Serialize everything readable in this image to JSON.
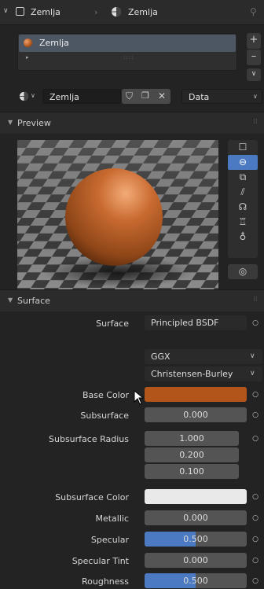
{
  "header": {
    "object_name": "Zemlja",
    "material_name": "Zemlja"
  },
  "slots": {
    "items": [
      "Zemlja"
    ],
    "add": "+",
    "remove": "–"
  },
  "material_selector": {
    "name": "Zemlja",
    "link_mode": "Data"
  },
  "panels": {
    "preview_title": "Preview",
    "surface_title": "Surface"
  },
  "surface": {
    "surface_label": "Surface",
    "surface_value": "Principled BSDF",
    "distribution": "GGX",
    "subsurface_method": "Christensen-Burley",
    "base_color_label": "Base Color",
    "base_color_hex": "#b1551b",
    "subsurface_label": "Subsurface",
    "subsurface_value": "0.000",
    "subsurface_radius_label": "Subsurface Radius",
    "subsurface_radius": [
      "1.000",
      "0.200",
      "0.100"
    ],
    "subsurface_color_label": "Subsurface Color",
    "subsurface_color_hex": "#e9e9e9",
    "metallic_label": "Metallic",
    "metallic_value": "0.000",
    "specular_label": "Specular",
    "specular_value": "0.500",
    "specular_fraction": 0.5,
    "specular_tint_label": "Specular Tint",
    "specular_tint_value": "0.000",
    "roughness_label": "Roughness",
    "roughness_value": "0.500",
    "roughness_fraction": 0.5
  },
  "colors": {
    "accent": "#4b7ac2",
    "slot_highlight": "#4d5764",
    "panel_bg": "#232323"
  },
  "icons": [
    "material-sphere-icon",
    "pin-icon",
    "shield-icon",
    "copy-icon",
    "close-icon",
    "flat-icon",
    "sphere-icon",
    "cube-icon",
    "hair-icon",
    "monkey-icon",
    "cloth-icon",
    "fluid-icon",
    "world-icon",
    "eyedropper-cursor-icon"
  ]
}
